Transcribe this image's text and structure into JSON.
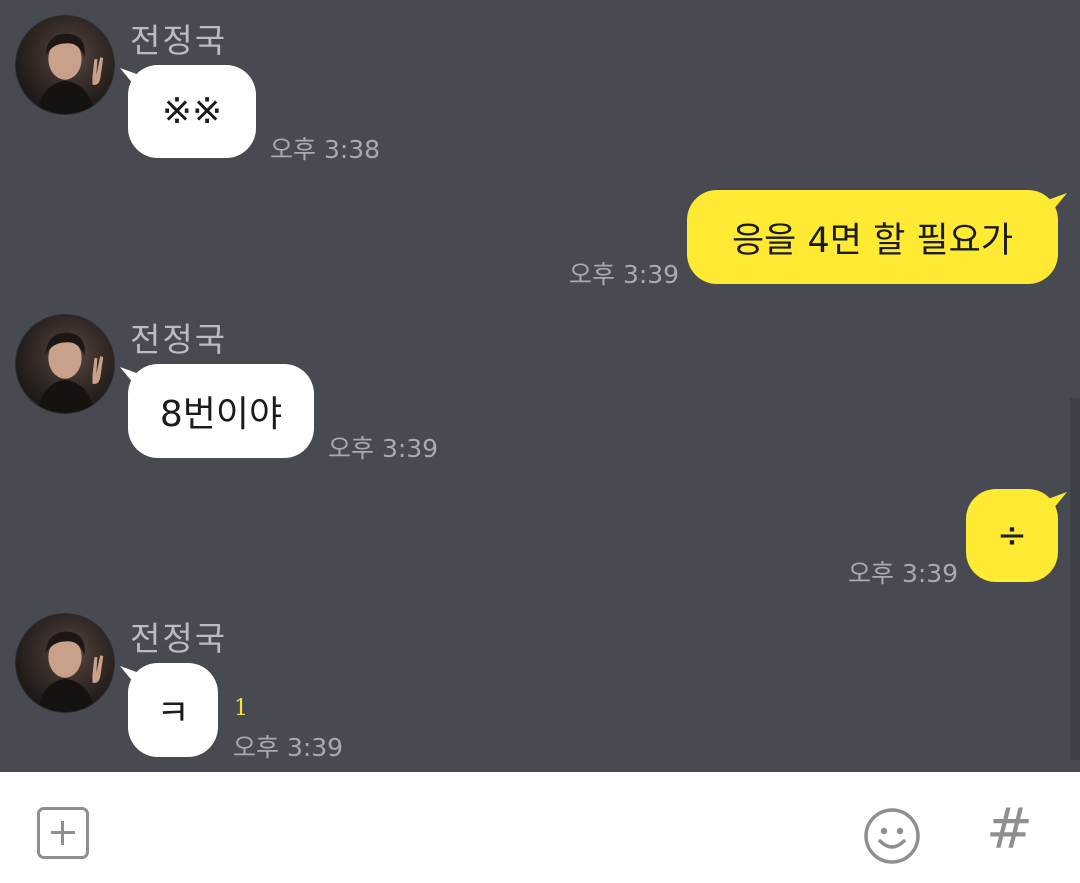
{
  "messages": [
    {
      "sender": "전정국",
      "text": "※※",
      "time": "오후 3:38",
      "direction": "in"
    },
    {
      "text": "응을 4면 할 필요가",
      "time": "오후 3:39",
      "direction": "out"
    },
    {
      "sender": "전정국",
      "text": "8번이야",
      "time": "오후 3:39",
      "direction": "in"
    },
    {
      "text": "÷",
      "time": "오후 3:39",
      "direction": "out"
    },
    {
      "sender": "전정국",
      "text": "ㅋ",
      "time": "오후 3:39",
      "direction": "in",
      "unread": "1"
    }
  ],
  "composer": {
    "add_icon": "plus-square-icon",
    "emoji_icon": "smiley-icon",
    "hash_icon": "hashtag-icon",
    "hash_label": "#"
  },
  "colors": {
    "background": "#474a51",
    "incoming_bubble": "#ffffff",
    "outgoing_bubble": "#fee933",
    "unread": "#f4e04d"
  }
}
